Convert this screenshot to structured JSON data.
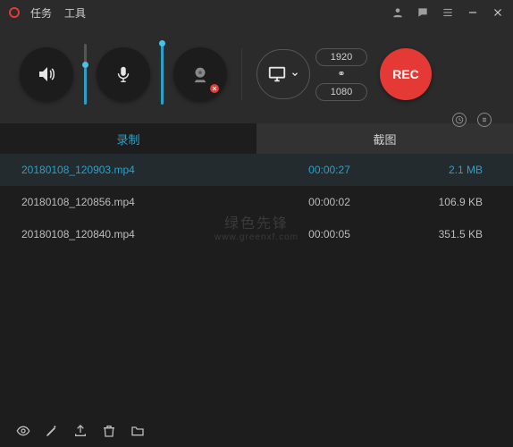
{
  "titlebar": {
    "menu": {
      "tasks": "任务",
      "tools": "工具"
    }
  },
  "toolbar": {
    "resolution": {
      "width": "1920",
      "height": "1080"
    },
    "rec_label": "REC"
  },
  "tabs": {
    "record": "录制",
    "screenshot": "截图"
  },
  "recordings": [
    {
      "name": "20180108_120903.mp4",
      "duration": "00:00:27",
      "size": "2.1 MB",
      "selected": true
    },
    {
      "name": "20180108_120856.mp4",
      "duration": "00:00:02",
      "size": "106.9 KB",
      "selected": false
    },
    {
      "name": "20180108_120840.mp4",
      "duration": "00:00:05",
      "size": "351.5 KB",
      "selected": false
    }
  ],
  "watermark": {
    "line1": "绿色先锋",
    "line2": "www.greenxf.com"
  },
  "sliders": {
    "speaker_pct": 60,
    "mic_pct": 98
  },
  "colors": {
    "accent": "#2aa0c8",
    "rec": "#e53935",
    "bg_dark": "#1d1d1d",
    "bg_mid": "#2b2b2b"
  }
}
